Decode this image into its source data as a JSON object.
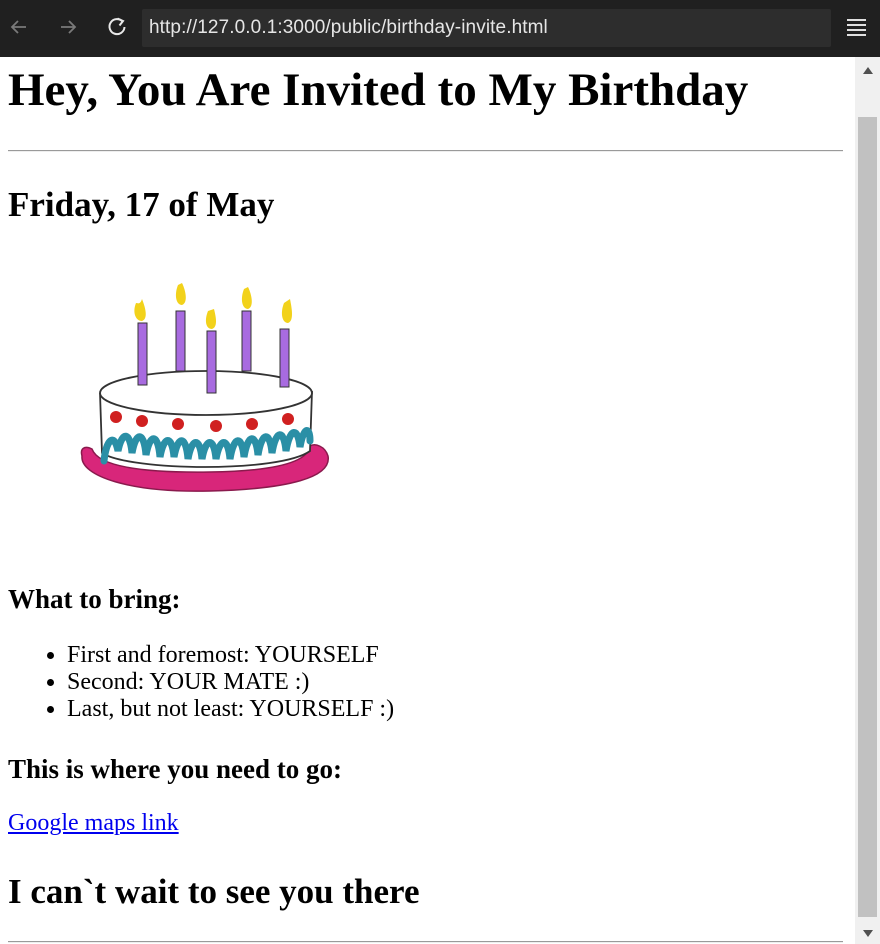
{
  "browser": {
    "url": "http://127.0.0.1:3000/public/birthday-invite.html"
  },
  "page": {
    "title": "Hey, You Are Invited to My Birthday",
    "date": "Friday, 17 of May",
    "what_to_bring": {
      "heading": "What to bring:",
      "items": [
        "First and foremost: YOURSELF",
        "Second: YOUR MATE :)",
        "Last, but not least: YOURSELF :)"
      ]
    },
    "where": {
      "heading": "This is where you need to go:",
      "link_text": "Google maps link"
    },
    "closing": "I can`t wait to see you there"
  },
  "icons": {
    "back": "arrow-left-icon",
    "forward": "arrow-right-icon",
    "reload": "reload-icon",
    "menu": "hamburger-menu-icon",
    "cake": "birthday-cake-illustration"
  },
  "colors": {
    "link": "#0000ee",
    "toolbar": "#202020",
    "candle": "#a86be0",
    "flame": "#f2d21b",
    "frosting": "#2a8fa6",
    "plate": "#d8267a",
    "cherry": "#d02020"
  }
}
